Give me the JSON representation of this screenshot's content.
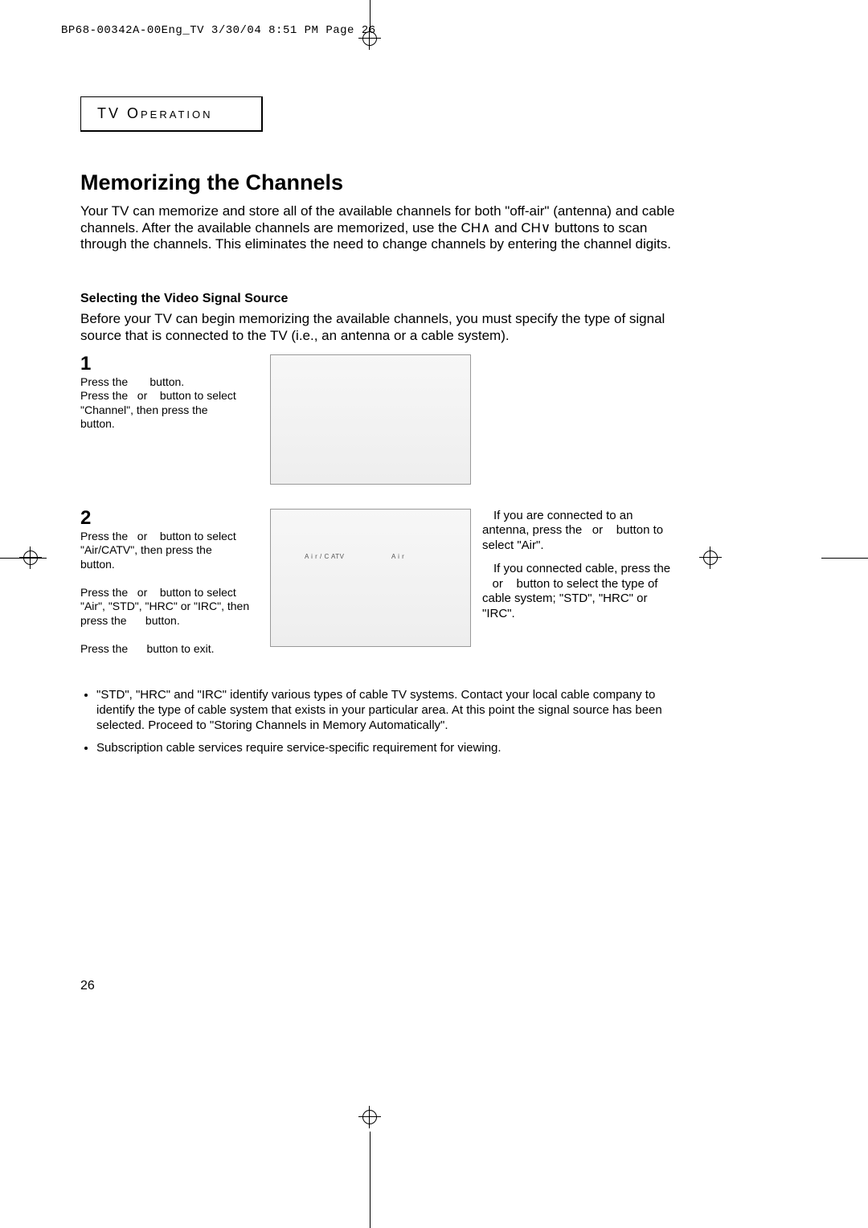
{
  "header_stamp": "BP68-00342A-00Eng_TV  3/30/04  8:51 PM  Page 26",
  "section_label": "TV Operation",
  "title": "Memorizing the Channels",
  "intro": "Your TV can memorize and store all of the available channels for both \"off-air\" (antenna) and cable channels. After the available channels are memorized, use the CH∧ and CH∨ buttons to scan through the channels. This eliminates the need to change channels by entering the channel digits.",
  "subheading": "Selecting the Video Signal Source",
  "subintro": "Before your TV can begin memorizing the available channels, you must specify the type of signal source that is connected to the TV (i.e., an antenna or a cable system).",
  "step1_num": "1",
  "step1_text": "Press the       button.\nPress the   or    button to select \"Channel\", then press the      button.",
  "step2_num": "2",
  "step2_text": "Press the   or    button to select \"Air/CATV\", then press the      button.\n\nPress the   or    button to select \"Air\", \"STD\", \"HRC\" or \"IRC\", then press the      button.\n\nPress the      button to exit.",
  "osd_label_left": "A i r / C ATV",
  "osd_label_right": "A i r",
  "side_p1": "If you are connected to an antenna, press the   or    button to select \"Air\".",
  "side_p2": "If you connected cable, press the    or    button to select the type of cable system; \"STD\", \"HRC\" or \"IRC\".",
  "note1": "\"STD\", \"HRC\" and \"IRC\" identify various types of cable TV systems. Contact your local cable company to identify the type of cable system that exists in your particular area. At this point the signal source has been selected. Proceed to \"Storing Channels in Memory Automatically\".",
  "note2": "Subscription cable services require service-specific requirement for viewing.",
  "pagenum": "26"
}
